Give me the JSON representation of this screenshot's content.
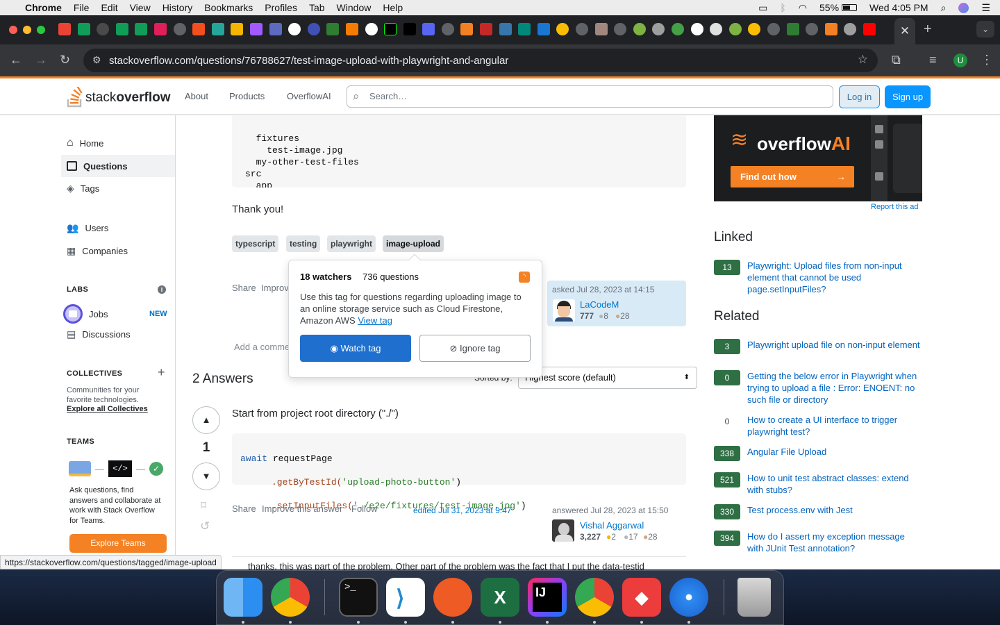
{
  "menubar": {
    "app_name": "Chrome",
    "items": [
      "File",
      "Edit",
      "View",
      "History",
      "Bookmarks",
      "Profiles",
      "Tab",
      "Window",
      "Help"
    ],
    "battery": "55%",
    "clock": "Wed 4:05 PM"
  },
  "browser": {
    "url": "stackoverflow.com/questions/76788627/test-image-upload-with-playwright-and-angular",
    "status_url": "https://stackoverflow.com/questions/tagged/image-upload",
    "profile_initial": "U"
  },
  "header": {
    "logo_text_1": "stack",
    "logo_text_2": "overflow",
    "nav": [
      "About",
      "Products",
      "OverflowAI"
    ],
    "search_placeholder": "Search…",
    "login": "Log in",
    "signup": "Sign up"
  },
  "sidebar": {
    "home": "Home",
    "questions": "Questions",
    "tags": "Tags",
    "users": "Users",
    "companies": "Companies",
    "labs_heading": "LABS",
    "jobs": "Jobs",
    "jobs_badge": "NEW",
    "discussions": "Discussions",
    "collectives_heading": "COLLECTIVES",
    "collectives_text": "Communities for your favorite technologies.",
    "collectives_link": "Explore all Collectives",
    "teams_heading": "TEAMS",
    "teams_text": "Ask questions, find answers and collaborate at work with Stack Overflow for Teams.",
    "teams_button": "Explore Teams"
  },
  "question": {
    "code_tail": "  fixtures\n    test-image.jpg\n  my-other-test-files\nsrc\n  app",
    "thanks": "Thank you!",
    "tags": [
      "typescript",
      "testing",
      "playwright",
      "image-upload"
    ],
    "share": "Share",
    "improve": "Improve",
    "asked": "asked Jul 28, 2023 at 14:15",
    "user": "LaCodeM",
    "rep": "777",
    "silver": "8",
    "bronze": "28",
    "add_comment": "Add a comment"
  },
  "tag_popup": {
    "watchers": "18 watchers",
    "questions": "736 questions",
    "description": "Use this tag for questions regarding uploading image to an online storage service such as Cloud Firestone, Amazon AWS",
    "view_tag": "View tag",
    "watch": "Watch tag",
    "ignore": "Ignore tag"
  },
  "answers": {
    "heading": "2 Answers",
    "sorted_by": "Sorted by:",
    "sort_value": "Highest score (default)",
    "score": "1",
    "text": "Start from project root directory (\"./\")",
    "code_line1_kw": "await",
    "code_line1_rest": " requestPage",
    "code_line2_fn": ".getByTestId(",
    "code_line2_str": "'upload-photo-button'",
    "code_line3_fn": ".setInputFiles(",
    "code_line3_str": "'./e2e/fixtures/test-image.jpg'",
    "share": "Share",
    "improve": "Improve this answer",
    "follow": "Follow",
    "edited": "edited Jul 31, 2023 at 9:47",
    "answered": "answered Jul 28, 2023 at 15:50",
    "user": "Vishal Aggarwal",
    "rep": "3,227",
    "gold": "2",
    "silver": "17",
    "bronze": "28",
    "comment_preview": "thanks, this was part of the problem. Other part of the problem was the fact that I put the data-testid"
  },
  "ad": {
    "brand": "overflow",
    "brand_ai": "AI",
    "cta": "Find out how",
    "report": "Report this ad"
  },
  "linked": {
    "heading": "Linked",
    "items": [
      {
        "score": "13",
        "title": "Playwright: Upload files from non-input element that cannot be used page.setInputFiles?"
      }
    ]
  },
  "related": {
    "heading": "Related",
    "items": [
      {
        "score": "3",
        "title": "Playwright upload file on non-input element"
      },
      {
        "score": "0",
        "title": "Getting the below error in Playwright when trying to upload a file : Error: ENOENT: no such file or directory"
      },
      {
        "score": "0",
        "title": "How to create a UI interface to trigger playwright test?"
      },
      {
        "score": "338",
        "title": "Angular File Upload"
      },
      {
        "score": "521",
        "title": "How to unit test abstract classes: extend with stubs?"
      },
      {
        "score": "330",
        "title": "Test process.env with Jest"
      },
      {
        "score": "394",
        "title": "How do I assert my exception message with JUnit Test annotation?"
      }
    ]
  },
  "colors": {
    "so_orange": "#f48225",
    "so_blue": "#0a95ff",
    "accepted_green": "#2f6f44"
  }
}
